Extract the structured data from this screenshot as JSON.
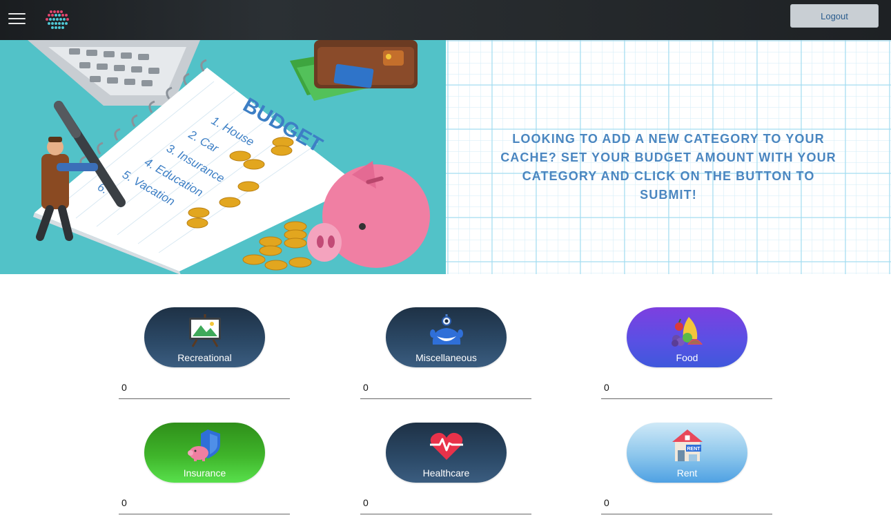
{
  "header": {
    "logout_label": "Logout"
  },
  "hero": {
    "message": "LOOKING TO ADD A NEW CATEGORY TO YOUR CACHE? SET YOUR BUDGET AMOUNT WITH YOUR CATEGORY AND CLICK ON THE BUTTON TO SUBMIT!",
    "illustration": {
      "heading": "BUDGET",
      "items": [
        "1. House",
        "2. Car",
        "3. Insurance",
        "4. Education",
        "5. Vacation",
        "6."
      ]
    }
  },
  "categories": [
    {
      "label": "Recreational",
      "value": "0",
      "icon": "easel-icon"
    },
    {
      "label": "Miscellaneous",
      "value": "0",
      "icon": "alien-icon"
    },
    {
      "label": "Food",
      "value": "0",
      "icon": "fruit-icon"
    },
    {
      "label": "Insurance",
      "value": "0",
      "icon": "piggy-shield-icon"
    },
    {
      "label": "Healthcare",
      "value": "0",
      "icon": "heartbeat-icon"
    },
    {
      "label": "Rent",
      "value": "0",
      "icon": "rent-house-icon"
    }
  ],
  "colors": {
    "hero_text": "#4a86c0",
    "hero_illustration_bg": "#52c2c8",
    "dark_button": "#2c4a68",
    "food_button": "#5a50e4",
    "insurance_button": "#3fb42a",
    "rent_button": "#8cc6ec"
  }
}
